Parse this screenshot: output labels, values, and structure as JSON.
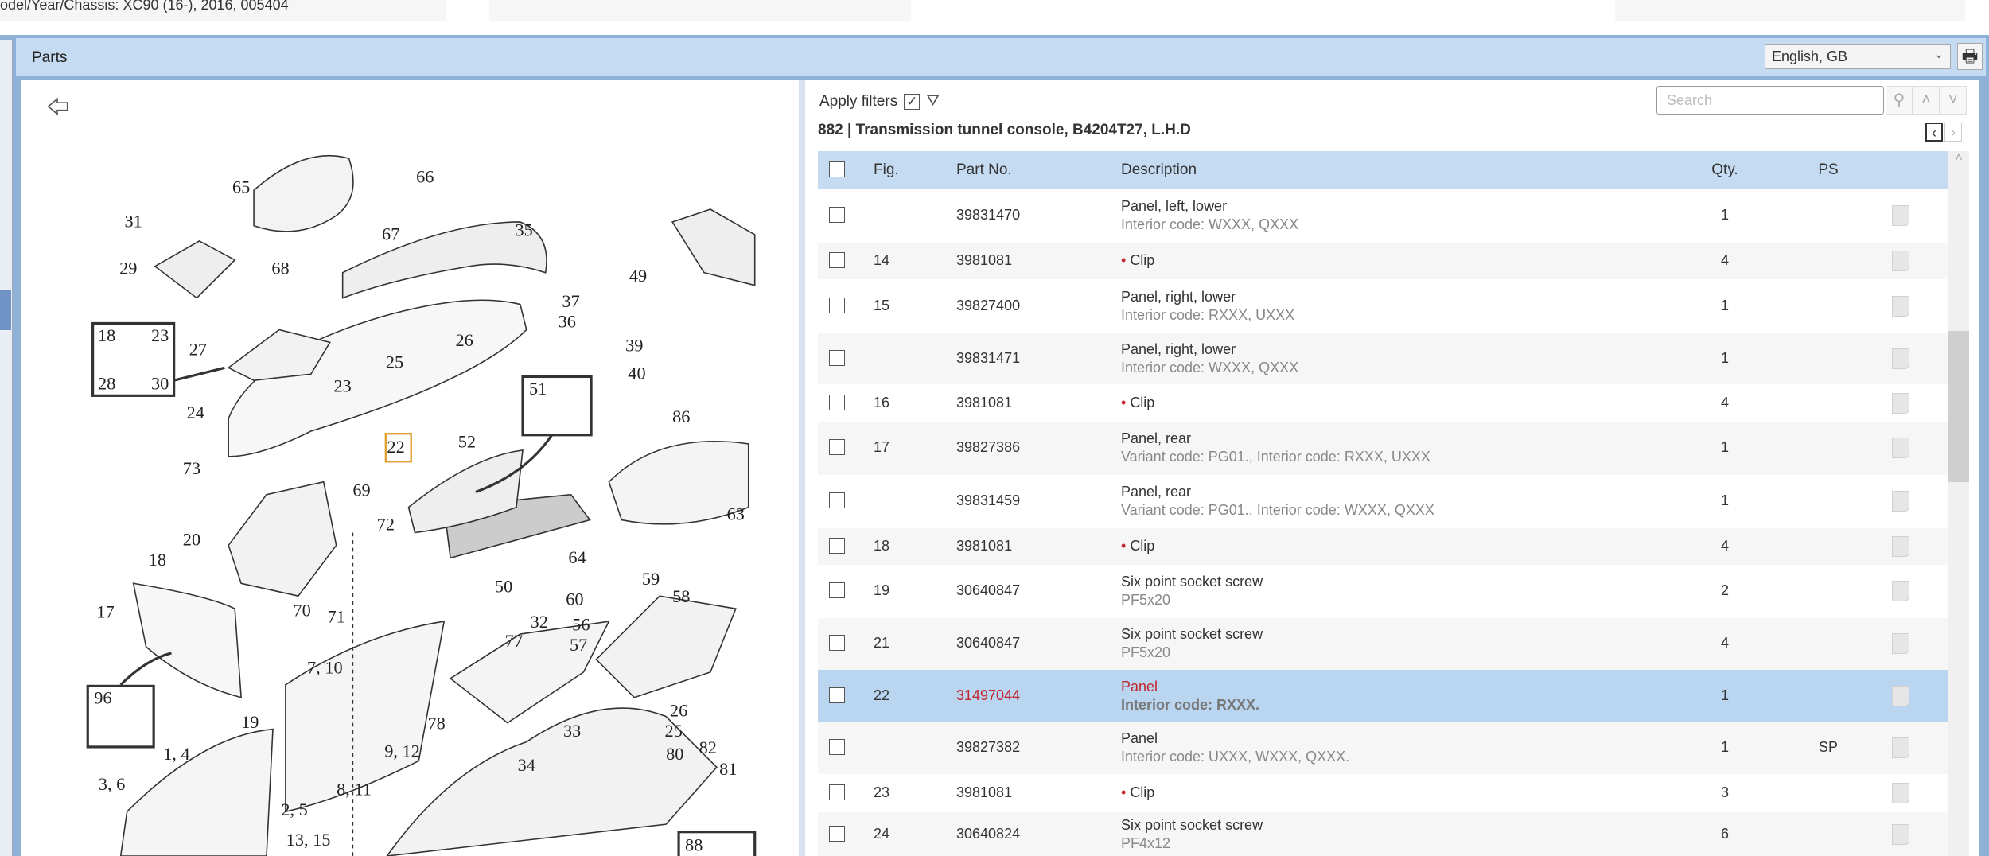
{
  "topbar": {
    "model_label": "odel/Year/Chassis:",
    "model_value": "XC90 (16-), 2016, 005404"
  },
  "header": {
    "title": "Parts",
    "language": "English, GB",
    "print_icon": "printer-icon"
  },
  "filters": {
    "label": "Apply filters",
    "checked": true
  },
  "search": {
    "placeholder": "Search"
  },
  "breadcrumb": "882  |  Transmission tunnel console, B4204T27, L.H.D",
  "table": {
    "headers": {
      "fig": "Fig.",
      "part": "Part No.",
      "desc": "Description",
      "qty": "Qty.",
      "ps": "PS"
    },
    "rows": [
      {
        "fig": "",
        "part": "39831470",
        "desc": "Panel, left, lower",
        "sub": "Interior code: WXXX, QXXX",
        "qty": "1",
        "ps": "",
        "bullet": false
      },
      {
        "fig": "14",
        "part": "3981081",
        "desc": "Clip",
        "sub": "",
        "qty": "4",
        "ps": "",
        "bullet": true
      },
      {
        "fig": "15",
        "part": "39827400",
        "desc": "Panel, right, lower",
        "sub": "Interior code: RXXX, UXXX",
        "qty": "1",
        "ps": "",
        "bullet": false
      },
      {
        "fig": "",
        "part": "39831471",
        "desc": "Panel, right, lower",
        "sub": "Interior code: WXXX, QXXX",
        "qty": "1",
        "ps": "",
        "bullet": false
      },
      {
        "fig": "16",
        "part": "3981081",
        "desc": "Clip",
        "sub": "",
        "qty": "4",
        "ps": "",
        "bullet": true
      },
      {
        "fig": "17",
        "part": "39827386",
        "desc": "Panel, rear",
        "sub": "Variant code: PG01., Interior code: RXXX, UXXX",
        "qty": "1",
        "ps": "",
        "bullet": false
      },
      {
        "fig": "",
        "part": "39831459",
        "desc": "Panel, rear",
        "sub": "Variant code: PG01., Interior code: WXXX, QXXX",
        "qty": "1",
        "ps": "",
        "bullet": false
      },
      {
        "fig": "18",
        "part": "3981081",
        "desc": "Clip",
        "sub": "",
        "qty": "4",
        "ps": "",
        "bullet": true
      },
      {
        "fig": "19",
        "part": "30640847",
        "desc": "Six point socket screw",
        "sub": "PF5x20",
        "qty": "2",
        "ps": "",
        "bullet": false
      },
      {
        "fig": "21",
        "part": "30640847",
        "desc": "Six point socket screw",
        "sub": "PF5x20",
        "qty": "4",
        "ps": "",
        "bullet": false
      },
      {
        "fig": "22",
        "part": "31497044",
        "desc": "Panel",
        "sub": "Interior code: RXXX.",
        "qty": "1",
        "ps": "",
        "bullet": false,
        "selected": true
      },
      {
        "fig": "",
        "part": "39827382",
        "desc": "Panel",
        "sub": "Interior code: UXXX, WXXX, QXXX.",
        "qty": "1",
        "ps": "SP",
        "bullet": false
      },
      {
        "fig": "23",
        "part": "3981081",
        "desc": "Clip",
        "sub": "",
        "qty": "3",
        "ps": "",
        "bullet": true
      },
      {
        "fig": "24",
        "part": "30640824",
        "desc": "Six point socket screw",
        "sub": "PF4x12",
        "qty": "6",
        "ps": "",
        "bullet": false
      }
    ]
  },
  "diagram": {
    "highlighted": "22",
    "callouts": [
      "65",
      "66",
      "31",
      "67",
      "35",
      "29",
      "68",
      "37",
      "49",
      "18",
      "23",
      "27",
      "26",
      "36",
      "39",
      "28",
      "30",
      "25",
      "40",
      "23",
      "51",
      "24",
      "86",
      "22",
      "52",
      "73",
      "69",
      "72",
      "63",
      "20",
      "64",
      "18",
      "50",
      "60",
      "59",
      "58",
      "56",
      "57",
      "17",
      "70",
      "71",
      "32",
      "77",
      "7, 10",
      "96",
      "26",
      "19",
      "33",
      "25",
      "78",
      "9, 12",
      "80",
      "82",
      "1, 4",
      "34",
      "81",
      "3, 6",
      "8, 11",
      "2, 5",
      "13, 15",
      "88"
    ]
  },
  "colors": {
    "accent": "#c5dbf2",
    "selected_row": "#b9d5f0",
    "highlight_red": "#c0262d"
  }
}
